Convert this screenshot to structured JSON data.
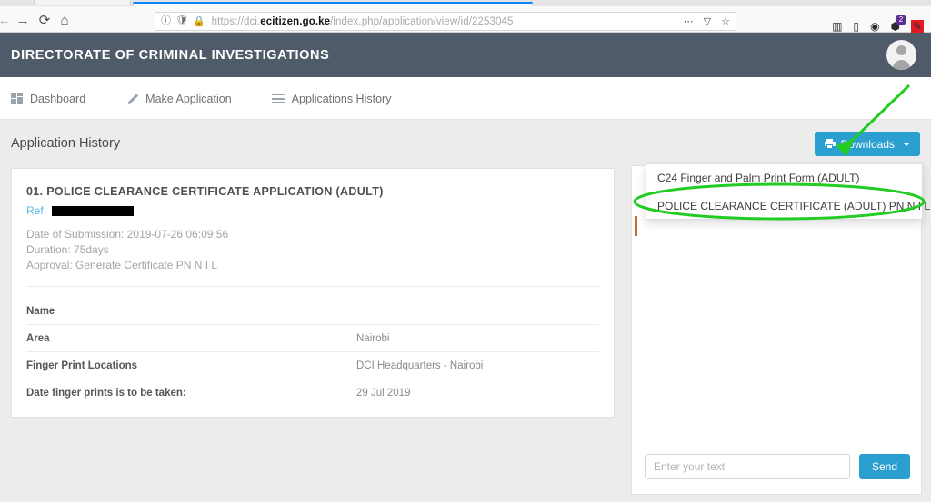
{
  "browser": {
    "url_prefix": "https://dci.",
    "url_domain": "ecitizen.go.ke",
    "url_path": "/index.php/application/view/id/2253045",
    "back_icon": "back-arrow-icon",
    "forward_icon": "forward-arrow-icon",
    "reload_icon": "reload-icon",
    "home_icon": "home-icon",
    "info_icon": "page-info-icon",
    "shield_icon": "tracking-protection-shield-icon",
    "lock_icon": "padlock-icon",
    "ellipsis_icon": "page-actions-icon",
    "pocket_icon": "pocket-icon",
    "star_icon": "bookmark-star-icon",
    "library_icon": "library-icon",
    "sidebar_icon": "sidebar-icon",
    "account_icon": "account-icon",
    "extension_icon": "extension-icon",
    "extension_badge": "2",
    "recorder_icon": "screen-recorder-icon",
    "glyphs": {
      "back": "←",
      "forward": "→",
      "reload": "⟳",
      "home": "⌂",
      "info": "ⓘ",
      "shield": "🛡",
      "lock": "🔒",
      "ellipsis": "⋯",
      "pocket": "▽",
      "star": "☆",
      "library": "▥",
      "sidebar": "▯",
      "account": "◉",
      "extension": "⬢",
      "recorder": "✎"
    }
  },
  "app": {
    "title": "DIRECTORATE OF CRIMINAL INVESTIGATIONS",
    "avatar_name": "user-avatar"
  },
  "nav": {
    "items": [
      {
        "label": "Dashboard",
        "icon": "grid-icon"
      },
      {
        "label": "Make Application",
        "icon": "pencil-icon"
      },
      {
        "label": "Applications History",
        "icon": "list-lines-icon"
      }
    ]
  },
  "page": {
    "title": "Application History"
  },
  "downloads_button": {
    "label": "Downloads",
    "icon": "printer-icon",
    "caret": "chevron-down-icon",
    "color": "#2b9fd0"
  },
  "dropdown": {
    "items": [
      "C24 Finger and Palm Print Form (ADULT)",
      "POLICE CLEARANCE CERTIFICATE (ADULT) PN N I L"
    ]
  },
  "card": {
    "title": "01. POLICE CLEARANCE CERTIFICATE APPLICATION (ADULT)",
    "ref_label": "Ref:",
    "ref_value_redacted": true,
    "meta": [
      "Date of Submission: 2019-07-26 06:09:56",
      "Duration: 75days",
      "Approval: Generate Certificate PN N I L"
    ],
    "rows": [
      {
        "key": "Name",
        "value": ""
      },
      {
        "key": "Area",
        "value": "Nairobi"
      },
      {
        "key": "Finger Print Locations",
        "value": "DCI Headquarters - Nairobi"
      },
      {
        "key": "Date finger prints is to be taken:",
        "value": "29 Jul 2019"
      }
    ]
  },
  "chat": {
    "input_placeholder": "Enter your text",
    "input_value": "",
    "send_label": "Send"
  },
  "annotations": {
    "arrow_color": "#22cc22",
    "ellipse_color": "#22cc22",
    "arrow_name": "green-arrow-pointing-to-downloads-button",
    "ellipse_name": "green-ellipse-highlighting-certificate-menu-item"
  },
  "colors": {
    "header_bg": "#4f5b69",
    "page_bg": "#ececec",
    "accent": "#2b9fd0",
    "ref_blue": "#5ab6e0"
  }
}
